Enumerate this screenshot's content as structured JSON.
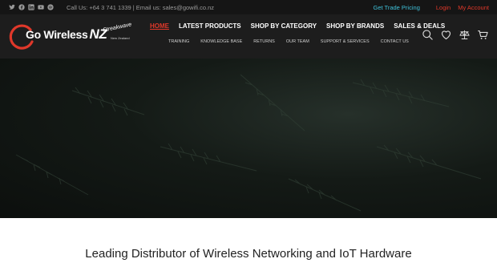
{
  "topbar": {
    "social_icons": [
      "twitter-icon",
      "facebook-icon",
      "linkedin-icon",
      "youtube-icon",
      "spotify-icon"
    ],
    "contact_text": "Call Us: +64 3 741 1339 | Email us: sales@gowifi.co.nz",
    "trade_pricing": "Get Trade Pricing",
    "login": "Login",
    "my_account": "My Account"
  },
  "logo": {
    "name": "Go Wireless",
    "country": "NZ",
    "partner": "Streakwave",
    "partner_sub": "New Zealand"
  },
  "nav": {
    "main": [
      "HOME",
      "LATEST PRODUCTS",
      "SHOP BY CATEGORY",
      "SHOP BY BRANDS",
      "SALES & DEALS"
    ],
    "sub": [
      "TRAINING",
      "KNOWLEDGE BASE",
      "RETURNS",
      "OUR TEAM",
      "SUPPORT & SERVICES",
      "CONTACT US"
    ]
  },
  "header_icons": [
    "search-icon",
    "heart-icon",
    "compare-scale-icon",
    "cart-icon"
  ],
  "headline": "Leading Distributor of Wireless Networking and IoT Hardware",
  "colors": {
    "accent_red": "#e0382a",
    "accent_cyan": "#3fc0d8",
    "topbar_bg": "#151515",
    "header_bg": "#1d1d1d"
  }
}
